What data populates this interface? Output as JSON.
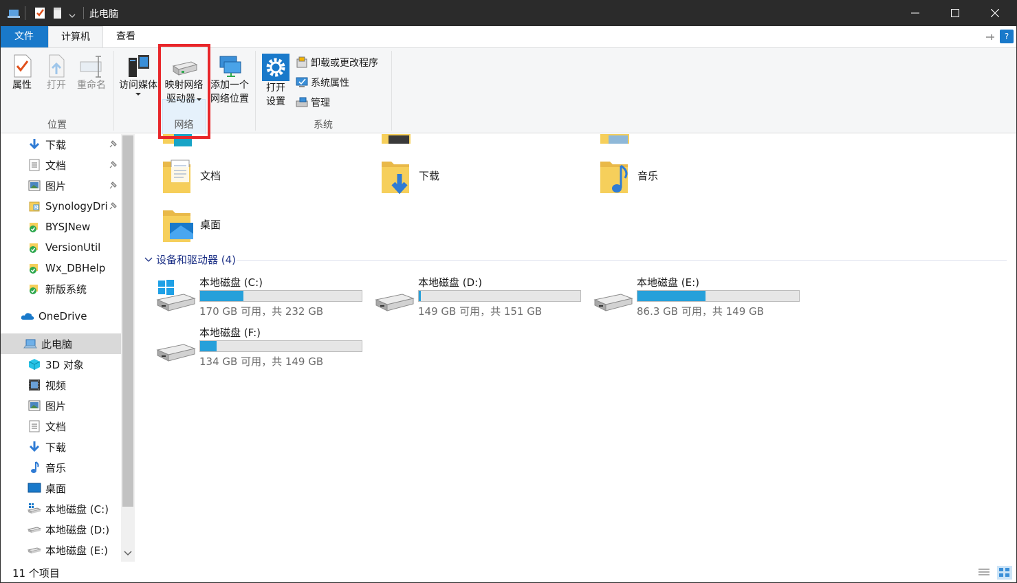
{
  "window": {
    "title": "此电脑"
  },
  "tabs": [
    {
      "label": "文件"
    },
    {
      "label": "计算机"
    },
    {
      "label": "查看"
    }
  ],
  "ribbon": {
    "location": {
      "label": "位置",
      "properties": "属性",
      "open": "打开",
      "rename": "重命名"
    },
    "network": {
      "label": "网络",
      "access_media": "访问媒体",
      "map_drive_1": "映射网络",
      "map_drive_2": "驱动器",
      "add_location_1": "添加一个",
      "add_location_2": "网络位置"
    },
    "system": {
      "label": "系统",
      "open_settings_1": "打开",
      "open_settings_2": "设置",
      "uninstall": "卸载或更改程序",
      "sys_props": "系统属性",
      "manage": "管理"
    }
  },
  "nav": {
    "items": [
      {
        "label": "下载",
        "icon": "download-icon",
        "pinned": true
      },
      {
        "label": "文档",
        "icon": "document-icon",
        "pinned": true
      },
      {
        "label": "图片",
        "icon": "picture-icon",
        "pinned": true
      },
      {
        "label": "SynologyDri",
        "icon": "synology-icon",
        "pinned": true
      },
      {
        "label": "BYSJNew",
        "icon": "synced-folder-icon"
      },
      {
        "label": "VersionUtil",
        "icon": "synced-folder-icon"
      },
      {
        "label": "Wx_DBHelp",
        "icon": "synced-folder-icon"
      },
      {
        "label": "新版系统",
        "icon": "synced-folder-icon"
      },
      {
        "label": "OneDrive",
        "icon": "onedrive-icon"
      },
      {
        "label": "此电脑",
        "icon": "this-pc-icon"
      },
      {
        "label": "3D 对象",
        "icon": "3d-objects-icon"
      },
      {
        "label": "视频",
        "icon": "video-icon"
      },
      {
        "label": "图片",
        "icon": "picture-icon"
      },
      {
        "label": "文档",
        "icon": "document-icon"
      },
      {
        "label": "下载",
        "icon": "download-icon"
      },
      {
        "label": "音乐",
        "icon": "music-icon"
      },
      {
        "label": "桌面",
        "icon": "desktop-icon"
      },
      {
        "label": "本地磁盘 (C:)",
        "icon": "windows-drive-icon"
      },
      {
        "label": "本地磁盘 (D:)",
        "icon": "drive-icon"
      },
      {
        "label": "本地磁盘 (E:)",
        "icon": "drive-icon"
      }
    ]
  },
  "folders": [
    {
      "name": "文档"
    },
    {
      "name": "下载"
    },
    {
      "name": "音乐"
    },
    {
      "name": "桌面"
    }
  ],
  "devices": {
    "header": "设备和驱动器 (4)",
    "drives": [
      {
        "name": "本地磁盘 (C:)",
        "info": "170 GB 可用，共 232 GB",
        "used_fraction": 0.267
      },
      {
        "name": "本地磁盘 (D:)",
        "info": "149 GB 可用，共 151 GB",
        "used_fraction": 0.013
      },
      {
        "name": "本地磁盘 (E:)",
        "info": "86.3 GB 可用，共 149 GB",
        "used_fraction": 0.42
      },
      {
        "name": "本地磁盘 (F:)",
        "info": "134 GB 可用，共 149 GB",
        "used_fraction": 0.1
      }
    ]
  },
  "status": {
    "count": "11 个项目"
  },
  "colors": {
    "accent": "#1979ca",
    "highlight": "#e8262a",
    "bar": "#26a0da"
  }
}
